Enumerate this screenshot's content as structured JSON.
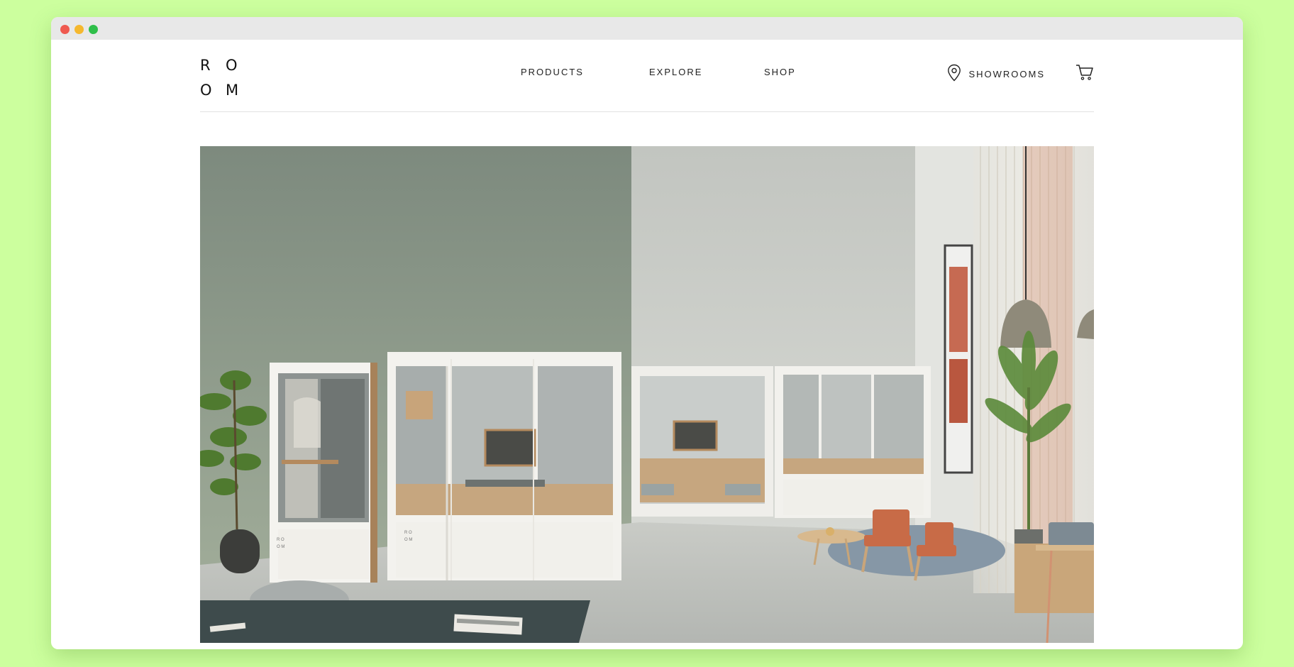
{
  "logo": {
    "line1": [
      "R",
      "O"
    ],
    "line2": [
      "O",
      "M"
    ]
  },
  "nav": {
    "products": "PRODUCTS",
    "explore": "EXPLORE",
    "shop": "SHOP"
  },
  "actions": {
    "showrooms": "SHOWROOMS"
  },
  "icons": {
    "location": "location-pin-icon",
    "cart": "shopping-cart-icon"
  },
  "colors": {
    "background": "#ccff9e",
    "text": "#222222"
  }
}
